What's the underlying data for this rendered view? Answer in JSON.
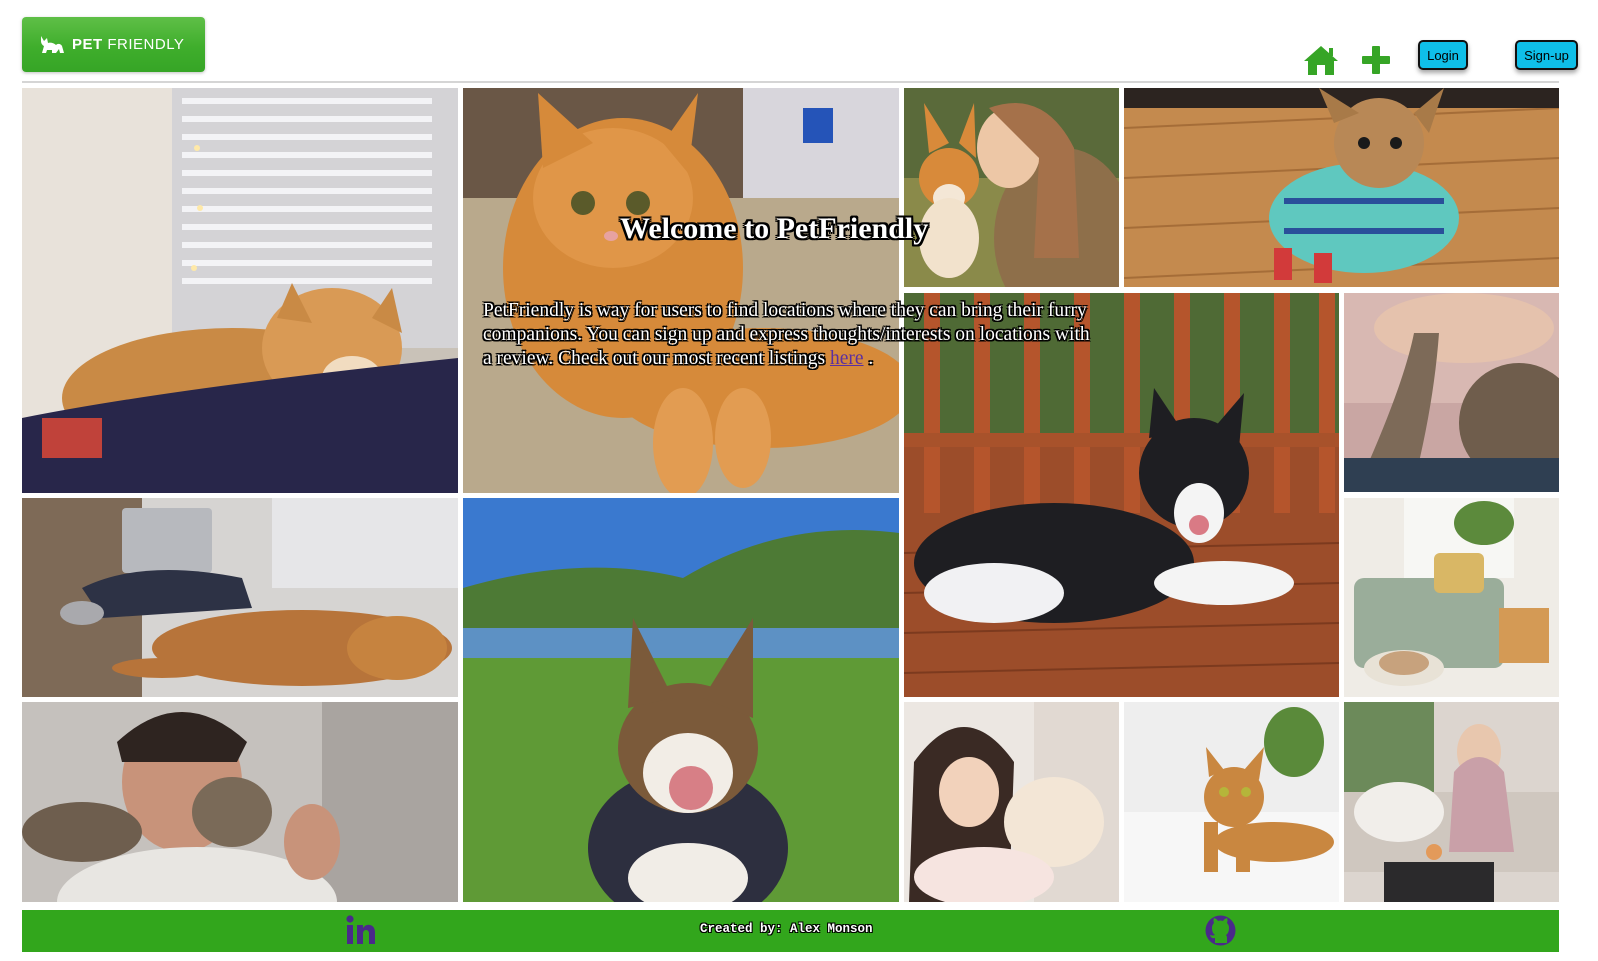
{
  "header": {
    "logo": {
      "bold": "PET",
      "light": "FRIENDLY",
      "icon": "cat-silhouette-icon"
    },
    "nav": {
      "home_icon": "home-icon",
      "add_icon": "plus-icon",
      "login_label": "Login",
      "signup_label": "Sign-up"
    },
    "colors": {
      "brand_green": "#3fae2c",
      "button_blue": "#0fbfe9"
    }
  },
  "hero": {
    "title": "Welcome to PetFriendly",
    "intro": "PetFriendly is way for users to find locations where they can bring their furry companions. You can sign up and express thoughts/interests on locations with a review. Check out our most recent listings",
    "link_text": "here",
    "after_link": "."
  },
  "gallery": {
    "tiles": [
      "shiba-inu-on-bed-photo",
      "orange-cat-on-carpet-photo",
      "corgi-and-woman-photo",
      "yorkie-in-sweater-photo",
      "border-collie-on-deck-photo",
      "hand-and-cat-paw-photo",
      "golden-retriever-sleeping-photo",
      "corgi-by-lake-photo",
      "cozy-living-room-with-dog-photo",
      "man-with-tabby-cat-photo",
      "woman-with-shar-pei-puppy-photo",
      "bengal-cat-on-bed-photo",
      "woman-on-sofa-with-dog-photo"
    ]
  },
  "footer": {
    "linkedin_icon": "linkedin-icon",
    "credit": "Created by: Alex Monson",
    "github_icon": "github-icon",
    "color": "#32a61c"
  }
}
